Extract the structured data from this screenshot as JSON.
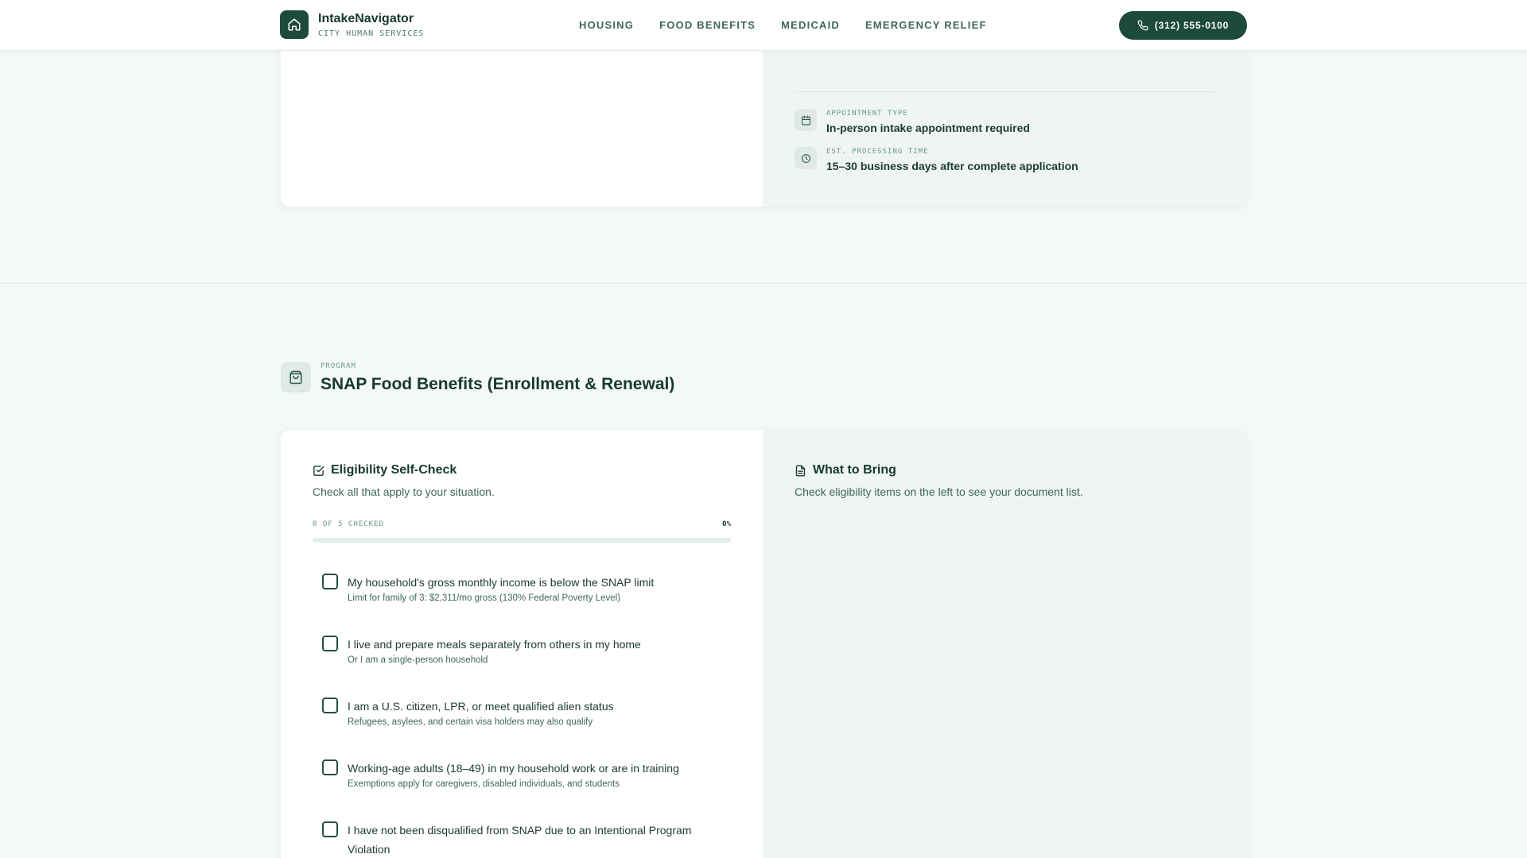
{
  "header": {
    "brand_name": "IntakeNavigator",
    "brand_sub": "CITY HUMAN SERVICES",
    "nav": [
      "HOUSING",
      "FOOD BENEFITS",
      "MEDICAID",
      "EMERGENCY RELIEF"
    ],
    "phone": "(312) 555-0100"
  },
  "top_card": {
    "appointment_label": "APPOINTMENT TYPE",
    "appointment_value": "In-person intake appointment required",
    "processing_label": "EST. PROCESSING TIME",
    "processing_value": "15–30 business days after complete application"
  },
  "program": {
    "label": "PROGRAM",
    "title": "SNAP Food Benefits (Enrollment & Renewal)"
  },
  "eligibility": {
    "title": "Eligibility Self-Check",
    "description": "Check all that apply to your situation.",
    "progress_label": "0 OF 5 CHECKED",
    "progress_pct": "0%",
    "progress_value": 0,
    "items": [
      {
        "main": "My household's gross monthly income is below the SNAP limit",
        "sub": "Limit for family of 3: $2,311/mo gross (130% Federal Poverty Level)",
        "checked": false
      },
      {
        "main": "I live and prepare meals separately from others in my home",
        "sub": "Or I am a single-person household",
        "checked": false
      },
      {
        "main": "I am a U.S. citizen, LPR, or meet qualified alien status",
        "sub": "Refugees, asylees, and certain visa holders may also qualify",
        "checked": false
      },
      {
        "main": "Working-age adults (18–49) in my household work or are in training",
        "sub": "Exemptions apply for caregivers, disabled individuals, and students",
        "checked": false
      },
      {
        "main": "I have not been disqualified from SNAP due to an Intentional Program Violation",
        "sub": "",
        "checked": false
      }
    ]
  },
  "what_to_bring": {
    "title": "What to Bring",
    "description": "Check eligibility items on the left to see your document list."
  },
  "colors": {
    "primary": "#1d4a3b",
    "accent_text": "#3d6858",
    "muted": "#6a9a88",
    "panel_bg": "#eff4f4"
  },
  "icons": {
    "brand": "home-icon",
    "phone": "phone-icon",
    "appointment": "calendar-icon",
    "processing": "clock-icon",
    "program": "shopping-bag-icon",
    "eligibility": "checkbox-icon",
    "bring": "document-icon"
  }
}
